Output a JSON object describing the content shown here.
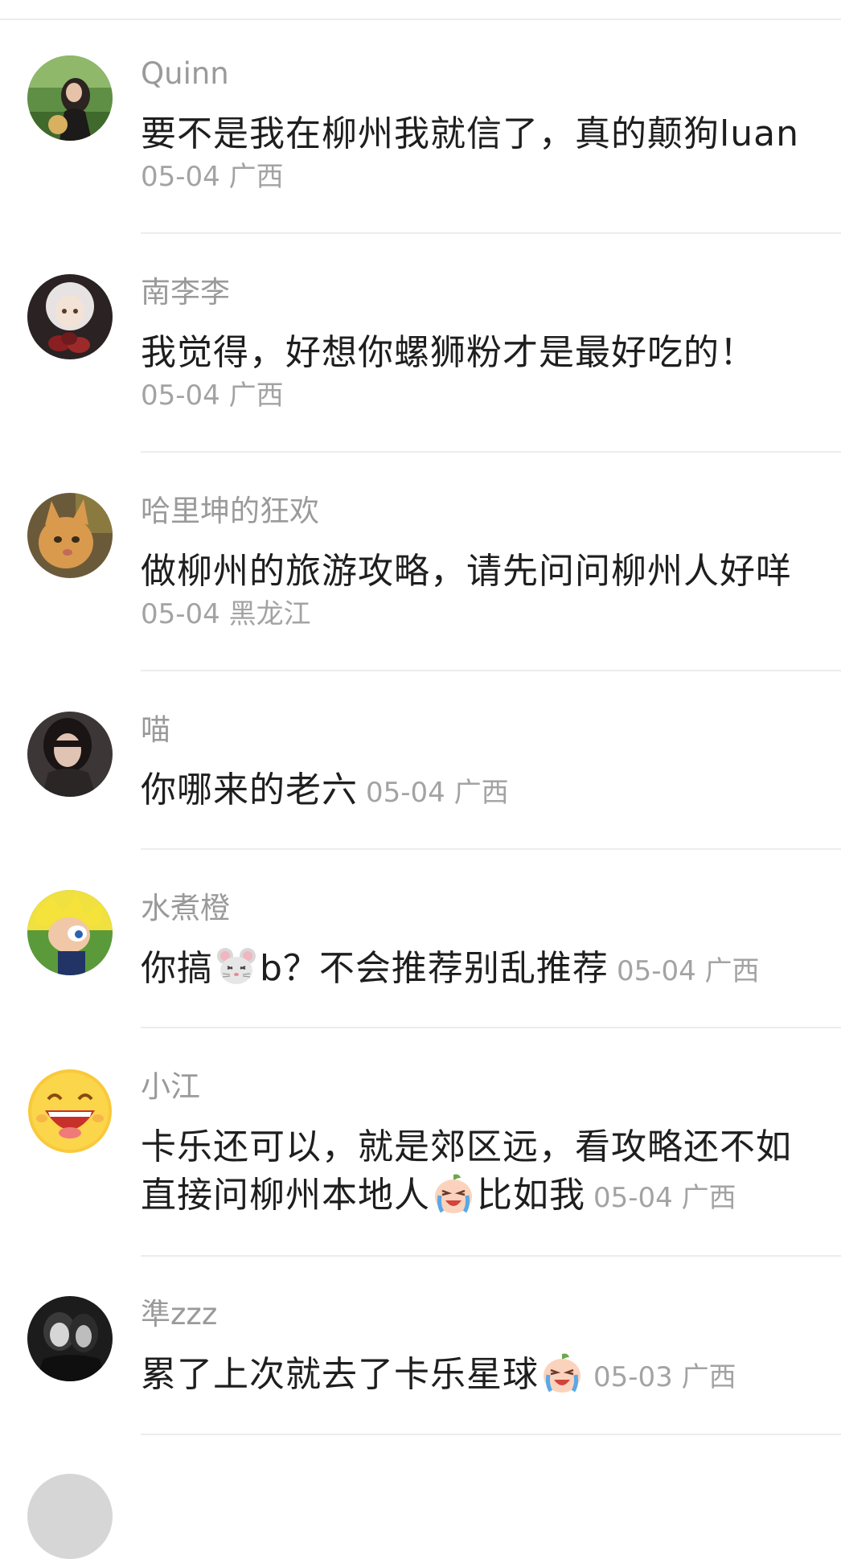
{
  "comments": [
    {
      "username": "Quinn",
      "text": "要不是我在柳州我就信了，真的颠狗luan",
      "date": "05-04",
      "region": "广西"
    },
    {
      "username": "南李李",
      "text": "我觉得，好想你螺狮粉才是最好吃的！",
      "date": "05-04",
      "region": "广西"
    },
    {
      "username": "哈里坤的狂欢",
      "text": "做柳州的旅游攻略，请先问问柳州人好咩",
      "date": "05-04",
      "region": "黑龙江"
    },
    {
      "username": "喵",
      "text": "你哪来的老六",
      "date": "05-04",
      "region": "广西"
    },
    {
      "username": "水煮橙",
      "text_a": "你搞",
      "text_b": "b？不会推荐别乱推荐",
      "date": "05-04",
      "region": "广西"
    },
    {
      "username": "小江",
      "text_line1": "卡乐还可以，就是郊区远，看攻略还不如",
      "text_line2a": "直接问柳州本地人",
      "text_line2b": "比如我",
      "date": "05-04",
      "region": "广西"
    },
    {
      "username": "準zzz",
      "text": "累了上次就去了卡乐星球",
      "date": "05-03",
      "region": "广西"
    }
  ],
  "icons": {
    "mouse_emoji": "mouse-face-emoji-icon",
    "crying_emoji": "crying-peach-emoji-icon",
    "laughing_avatar": "laughing-face-icon"
  }
}
